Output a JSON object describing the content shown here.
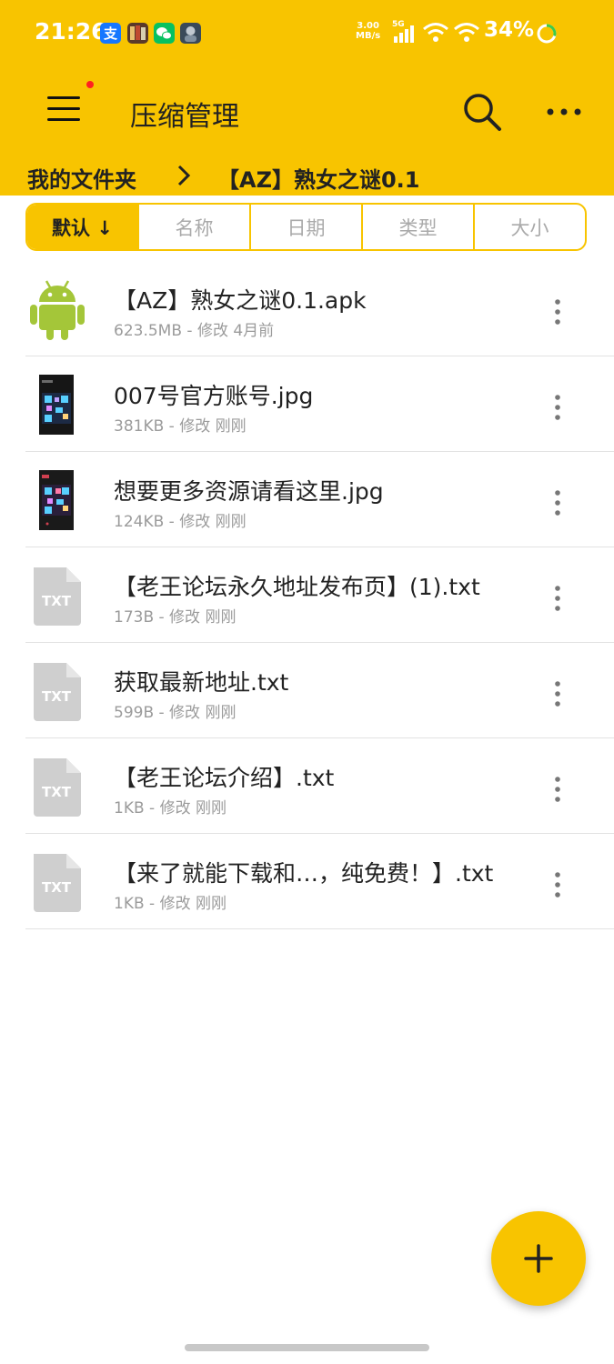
{
  "status_bar": {
    "time": "21:26",
    "net_speed_value": "3.00",
    "net_speed_unit": "MB/s",
    "network_type": "5G",
    "battery": "34%"
  },
  "header": {
    "title": "压缩管理",
    "menu_icon": "hamburger-icon",
    "search_icon": "search-icon",
    "more_icon": "more-horizontal-icon"
  },
  "breadcrumb": {
    "root": "我的文件夹",
    "current": "【AZ】熟女之谜0.1"
  },
  "sort_tabs": [
    "默认 ↓",
    "名称",
    "日期",
    "类型",
    "大小"
  ],
  "files": [
    {
      "name": "【AZ】熟女之谜0.1.apk",
      "meta": "623.5MB - 修改 4月前",
      "type": "apk"
    },
    {
      "name": "007号官方账号.jpg",
      "meta": "381KB - 修改 刚刚",
      "type": "jpg"
    },
    {
      "name": "想要更多资源请看这里.jpg",
      "meta": "124KB - 修改 刚刚",
      "type": "jpg"
    },
    {
      "name": "【老王论坛永久地址发布页】(1).txt",
      "meta": "173B - 修改 刚刚",
      "type": "txt"
    },
    {
      "name": "获取最新地址.txt",
      "meta": "599B - 修改 刚刚",
      "type": "txt"
    },
    {
      "name": "【老王论坛介绍】.txt",
      "meta": "1KB - 修改 刚刚",
      "type": "txt"
    },
    {
      "name": "【来了就能下载和…，纯免费！】.txt",
      "meta": "1KB - 修改 刚刚",
      "type": "txt"
    }
  ],
  "txt_badge": "TXT",
  "colors": {
    "accent": "#f8c400",
    "text_primary": "#222222",
    "text_secondary": "#9b9b9b",
    "android_green": "#a4c639"
  }
}
